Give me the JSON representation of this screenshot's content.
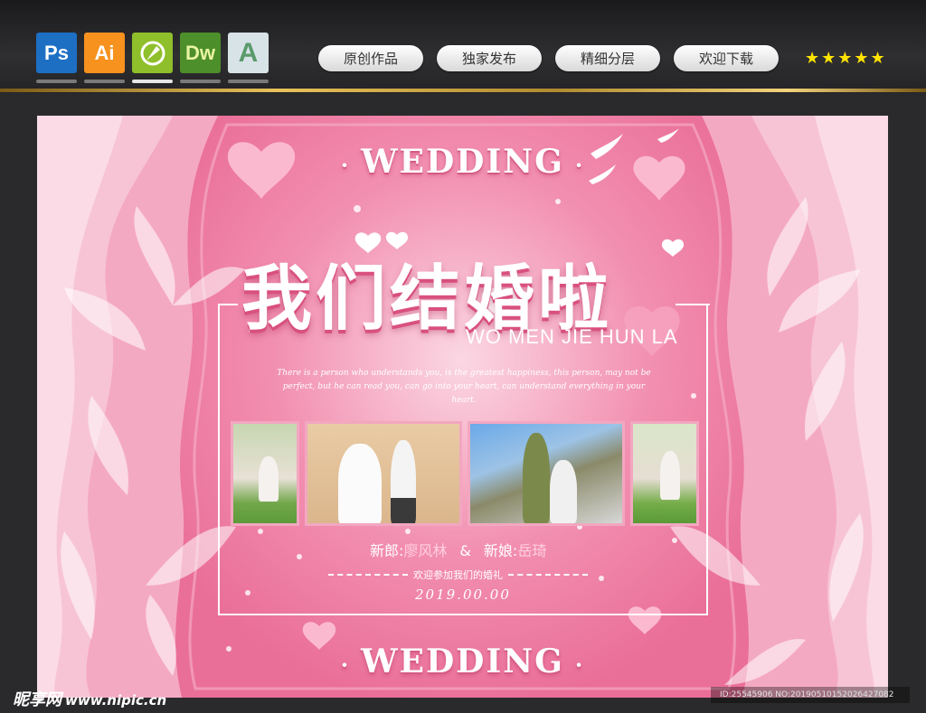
{
  "toolbar": {
    "apps": [
      {
        "label": "Ps",
        "icon": "photoshop-icon",
        "bg": "#1d6fc4",
        "fg": "#ffffff",
        "active": false
      },
      {
        "label": "Ai",
        "icon": "illustrator-icon",
        "bg": "#f7921e",
        "fg": "#ffffff",
        "active": false
      },
      {
        "label": "",
        "icon": "coreldraw-icon",
        "bg": "#8fbf2a",
        "fg": "#ffffff",
        "active": true
      },
      {
        "label": "Dw",
        "icon": "dreamweaver-icon",
        "bg": "#4d8f2a",
        "fg": "#e8f5a0",
        "active": false
      },
      {
        "label": "A",
        "icon": "font-app-icon",
        "bg": "#d8e3e8",
        "fg": "#5a9a6a",
        "active": false
      }
    ],
    "pills": [
      "原创作品",
      "独家发布",
      "精细分层",
      "欢迎下载"
    ],
    "stars": "★★★★★"
  },
  "poster": {
    "wedding_top": "WEDDING",
    "wedding_bottom": "WEDDING",
    "headline": "我们结婚啦",
    "pinyin": "WO MEN JIE HUN LA",
    "quote": "There is a person who understands you, is the greatest happiness, this person, may not be perfect, but he can read you, can go into your heart, can understand everything in your heart.",
    "groom_label": "新郎:",
    "groom_name": "廖风林",
    "amp": "&",
    "bride_label": "新娘:",
    "bride_name": "岳琦",
    "invite": "欢迎参加我们的婚礼",
    "date": "2019.00.00",
    "colors": {
      "pink": "#ef7fa2",
      "light_pink": "#fbd3e0",
      "accent": "#d9507f"
    }
  },
  "footer": {
    "logo_text": "昵享网",
    "logo_url": "www.nipic.cn",
    "meta": "ID:25545906 NO:20190510152026427082"
  }
}
